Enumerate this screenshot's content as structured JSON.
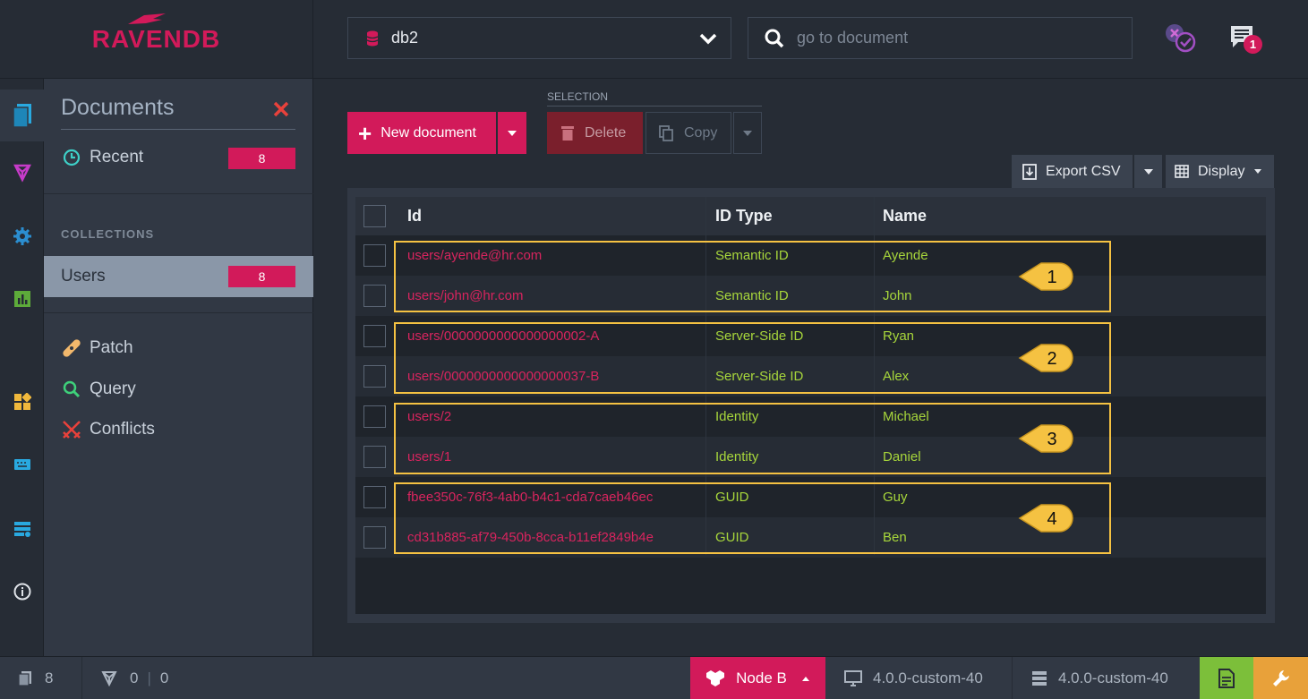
{
  "header": {
    "logo_text": "RAVENDB",
    "database": "db2",
    "search_placeholder": "go to document",
    "notification_count": "1"
  },
  "menu": {
    "title": "Documents",
    "recent_label": "Recent",
    "recent_count": "8",
    "collections_heading": "COLLECTIONS",
    "collection_name": "Users",
    "collection_count": "8",
    "patch_label": "Patch",
    "query_label": "Query",
    "conflicts_label": "Conflicts"
  },
  "toolbar": {
    "new_document": "New document",
    "selection_heading": "SELECTION",
    "delete": "Delete",
    "copy": "Copy",
    "export_csv": "Export CSV",
    "display": "Display"
  },
  "grid": {
    "columns": [
      "Id",
      "ID Type",
      "Name"
    ],
    "rows": [
      {
        "id": "users/ayende@hr.com",
        "type": "Semantic ID",
        "name": "Ayende"
      },
      {
        "id": "users/john@hr.com",
        "type": "Semantic ID",
        "name": "John"
      },
      {
        "id": "users/0000000000000000002-A",
        "type": "Server-Side ID",
        "name": "Ryan"
      },
      {
        "id": "users/0000000000000000037-B",
        "type": "Server-Side ID",
        "name": "Alex"
      },
      {
        "id": "users/2",
        "type": "Identity",
        "name": "Michael"
      },
      {
        "id": "users/1",
        "type": "Identity",
        "name": "Daniel"
      },
      {
        "id": "fbee350c-76f3-4ab0-b4c1-cda7caeb46ec",
        "type": "GUID",
        "name": "Guy"
      },
      {
        "id": "cd31b885-af79-450b-8cca-b11ef2849b4e",
        "type": "GUID",
        "name": "Ben"
      }
    ],
    "callouts": [
      "1",
      "2",
      "3",
      "4"
    ]
  },
  "status": {
    "doc_count": "8",
    "index_count": "0",
    "index_errors": "0",
    "node": "Node B",
    "client_version": "4.0.0-custom-40",
    "server_version": "4.0.0-custom-40"
  },
  "colors": {
    "brand": "#d21a5a",
    "highlight": "#f5c242",
    "value_green": "#a7d63b"
  }
}
